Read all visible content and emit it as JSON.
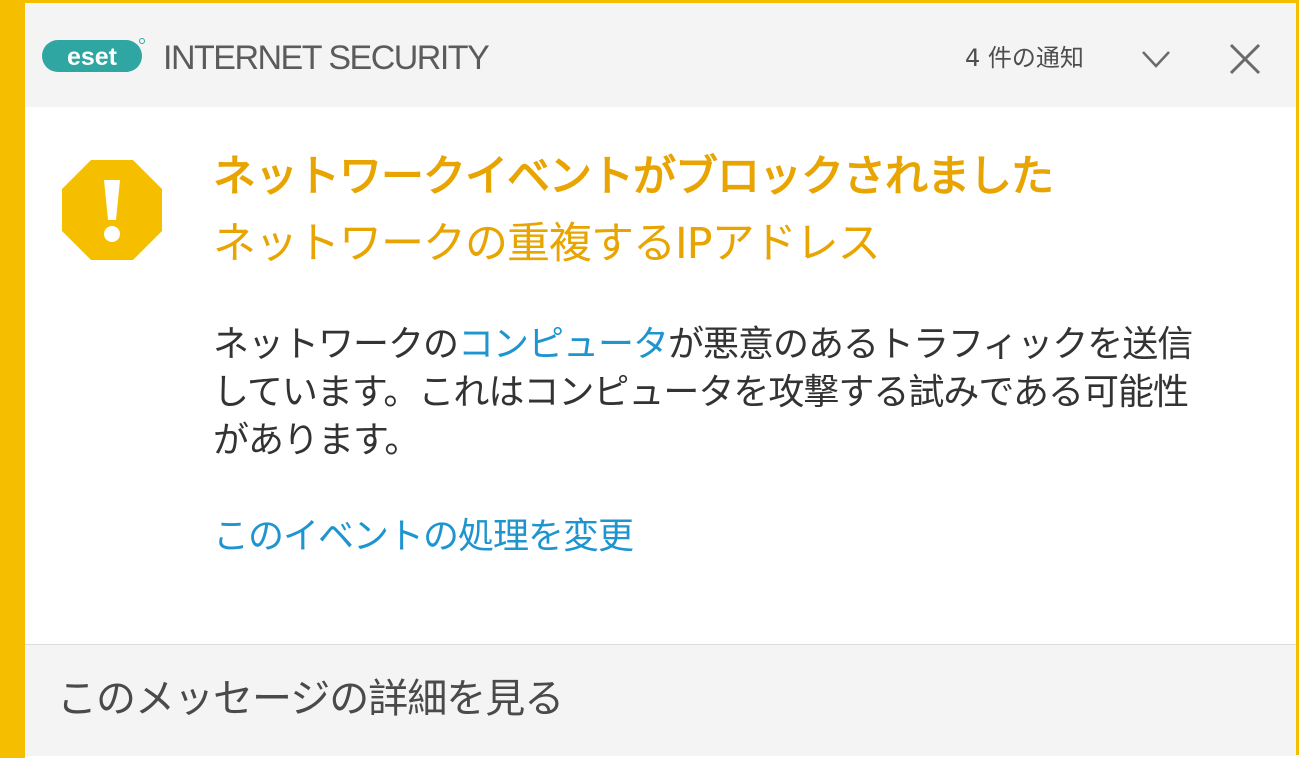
{
  "colors": {
    "accent": "#f5bf00",
    "title": "#e8a400",
    "link": "#1f95cf",
    "logo": "#2fa6a2"
  },
  "header": {
    "logo_text": "eset",
    "product_name": "INTERNET SECURITY",
    "notification_count": "4 件の通知",
    "chevron_icon": "chevron-down-icon",
    "close_icon": "close-icon"
  },
  "alert": {
    "icon": "warning-octagon-icon",
    "title": "ネットワークイベントがブロックされました",
    "subtitle": "ネットワークの重複するIPアドレス",
    "message_before": "ネットワークの",
    "message_link": "コンピュータ",
    "message_after": "が悪意のあるトラフィックを送信しています。これはコンピュータを攻撃する試みである可能性があります。",
    "action_link": "このイベントの処理を変更"
  },
  "footer": {
    "details_label": "このメッセージの詳細を見る"
  }
}
